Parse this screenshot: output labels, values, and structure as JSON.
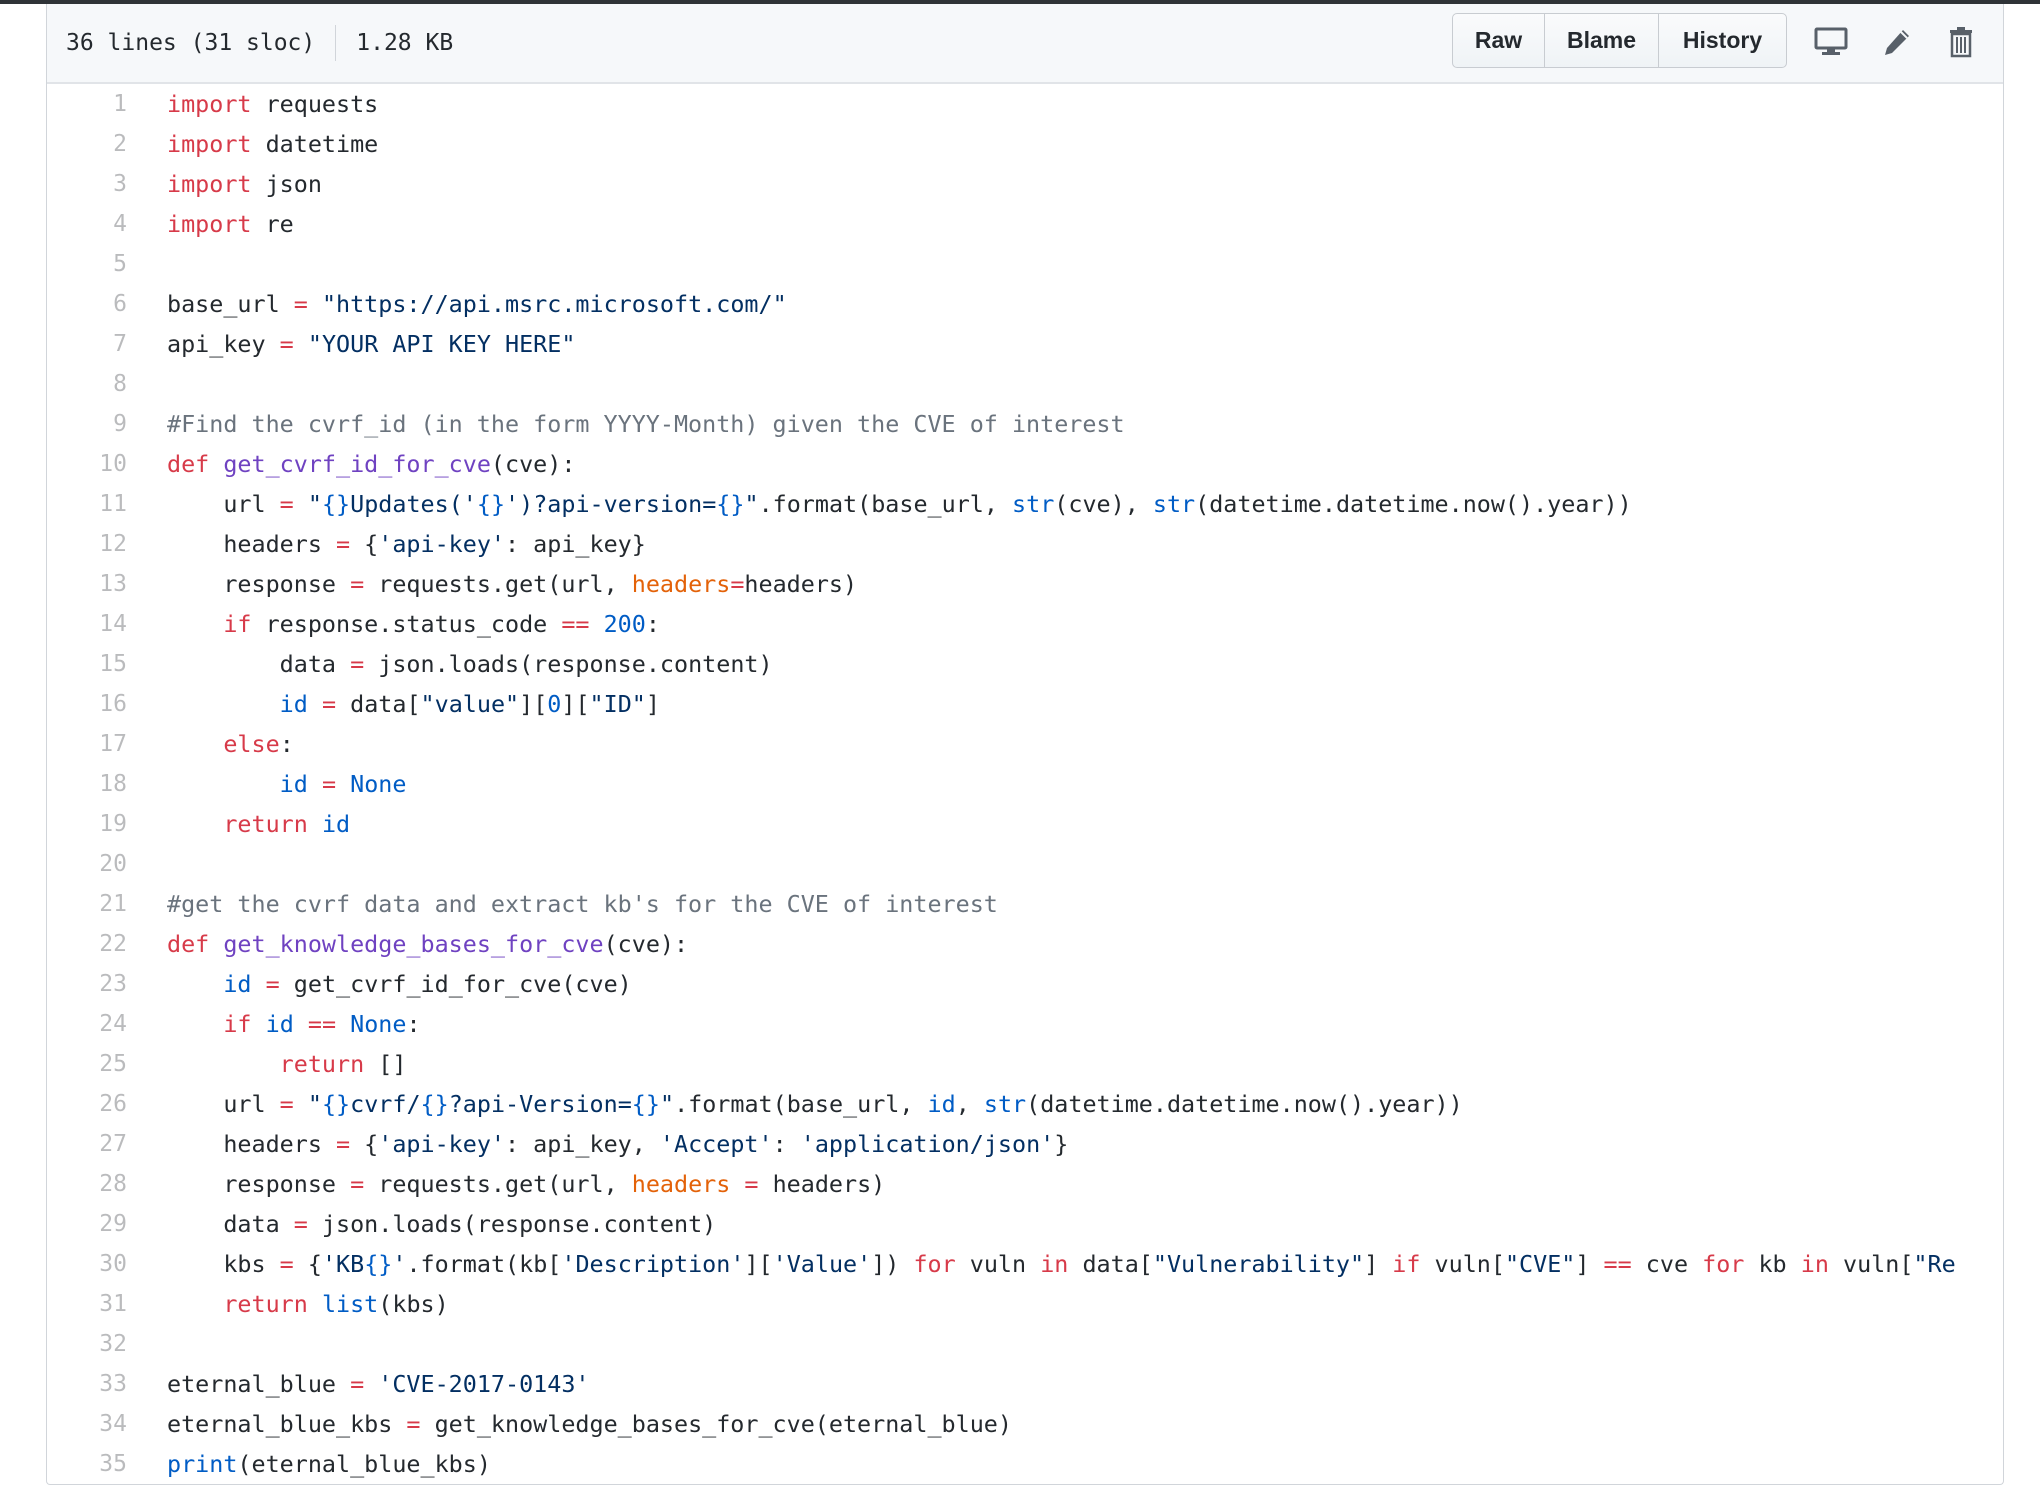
{
  "file_info": {
    "lines": "36 lines (31 sloc)",
    "size": "1.28 KB"
  },
  "actions": {
    "raw": "Raw",
    "blame": "Blame",
    "history": "History",
    "icons": [
      "desktop-icon",
      "pencil-icon",
      "trash-icon"
    ]
  },
  "colors": {
    "keyword": "#d73a49",
    "function": "#6f42c1",
    "string": "#032f62",
    "constant": "#005cc5",
    "parameter": "#e36209",
    "comment": "#6a737d",
    "text": "#24292e"
  },
  "lines": [
    {
      "n": "1",
      "tokens": [
        [
          "k",
          "import"
        ],
        [
          "t",
          " requests"
        ]
      ]
    },
    {
      "n": "2",
      "tokens": [
        [
          "k",
          "import"
        ],
        [
          "t",
          " datetime"
        ]
      ]
    },
    {
      "n": "3",
      "tokens": [
        [
          "k",
          "import"
        ],
        [
          "t",
          " json"
        ]
      ]
    },
    {
      "n": "4",
      "tokens": [
        [
          "k",
          "import"
        ],
        [
          "t",
          " re"
        ]
      ]
    },
    {
      "n": "5",
      "tokens": []
    },
    {
      "n": "6",
      "tokens": [
        [
          "t",
          "base_url "
        ],
        [
          "k",
          "="
        ],
        [
          "t",
          " "
        ],
        [
          "s",
          "\"https://api.msrc.microsoft.com/\""
        ]
      ]
    },
    {
      "n": "7",
      "tokens": [
        [
          "t",
          "api_key "
        ],
        [
          "k",
          "="
        ],
        [
          "t",
          " "
        ],
        [
          "s",
          "\"YOUR API KEY HERE\""
        ]
      ]
    },
    {
      "n": "8",
      "tokens": []
    },
    {
      "n": "9",
      "tokens": [
        [
          "c",
          "#Find the cvrf_id (in the form YYYY-Month) given the CVE of interest"
        ]
      ]
    },
    {
      "n": "10",
      "tokens": [
        [
          "k",
          "def"
        ],
        [
          "t",
          " "
        ],
        [
          "f",
          "get_cvrf_id_for_cve"
        ],
        [
          "t",
          "(cve):"
        ]
      ]
    },
    {
      "n": "11",
      "tokens": [
        [
          "t",
          "    url "
        ],
        [
          "k",
          "="
        ],
        [
          "t",
          " "
        ],
        [
          "s",
          "\""
        ],
        [
          "n",
          "{}"
        ],
        [
          "s",
          "Updates('"
        ],
        [
          "n",
          "{}"
        ],
        [
          "s",
          "')?api-version="
        ],
        [
          "n",
          "{}"
        ],
        [
          "s",
          "\""
        ],
        [
          "t",
          ".format(base_url, "
        ],
        [
          "n",
          "str"
        ],
        [
          "t",
          "(cve), "
        ],
        [
          "n",
          "str"
        ],
        [
          "t",
          "(datetime.datetime.now().year))"
        ]
      ]
    },
    {
      "n": "12",
      "tokens": [
        [
          "t",
          "    headers "
        ],
        [
          "k",
          "="
        ],
        [
          "t",
          " {"
        ],
        [
          "s",
          "'api-key'"
        ],
        [
          "t",
          ": api_key}"
        ]
      ]
    },
    {
      "n": "13",
      "tokens": [
        [
          "t",
          "    response "
        ],
        [
          "k",
          "="
        ],
        [
          "t",
          " requests.get(url, "
        ],
        [
          "o",
          "headers"
        ],
        [
          "k",
          "="
        ],
        [
          "t",
          "headers)"
        ]
      ]
    },
    {
      "n": "14",
      "tokens": [
        [
          "t",
          "    "
        ],
        [
          "k",
          "if"
        ],
        [
          "t",
          " response.status_code "
        ],
        [
          "k",
          "=="
        ],
        [
          "t",
          " "
        ],
        [
          "n",
          "200"
        ],
        [
          "t",
          ":"
        ]
      ]
    },
    {
      "n": "15",
      "tokens": [
        [
          "t",
          "        data "
        ],
        [
          "k",
          "="
        ],
        [
          "t",
          " json.loads(response.content)"
        ]
      ]
    },
    {
      "n": "16",
      "tokens": [
        [
          "t",
          "        "
        ],
        [
          "n",
          "id"
        ],
        [
          "t",
          " "
        ],
        [
          "k",
          "="
        ],
        [
          "t",
          " data["
        ],
        [
          "s",
          "\"value\""
        ],
        [
          "t",
          "]["
        ],
        [
          "n",
          "0"
        ],
        [
          "t",
          "]["
        ],
        [
          "s",
          "\"ID\""
        ],
        [
          "t",
          "]"
        ]
      ]
    },
    {
      "n": "17",
      "tokens": [
        [
          "t",
          "    "
        ],
        [
          "k",
          "else"
        ],
        [
          "t",
          ":"
        ]
      ]
    },
    {
      "n": "18",
      "tokens": [
        [
          "t",
          "        "
        ],
        [
          "n",
          "id"
        ],
        [
          "t",
          " "
        ],
        [
          "k",
          "="
        ],
        [
          "t",
          " "
        ],
        [
          "n",
          "None"
        ]
      ]
    },
    {
      "n": "19",
      "tokens": [
        [
          "t",
          "    "
        ],
        [
          "k",
          "return"
        ],
        [
          "t",
          " "
        ],
        [
          "n",
          "id"
        ]
      ]
    },
    {
      "n": "20",
      "tokens": []
    },
    {
      "n": "21",
      "tokens": [
        [
          "c",
          "#get the cvrf data and extract kb's for the CVE of interest"
        ]
      ]
    },
    {
      "n": "22",
      "tokens": [
        [
          "k",
          "def"
        ],
        [
          "t",
          " "
        ],
        [
          "f",
          "get_knowledge_bases_for_cve"
        ],
        [
          "t",
          "(cve):"
        ]
      ]
    },
    {
      "n": "23",
      "tokens": [
        [
          "t",
          "    "
        ],
        [
          "n",
          "id"
        ],
        [
          "t",
          " "
        ],
        [
          "k",
          "="
        ],
        [
          "t",
          " get_cvrf_id_for_cve(cve)"
        ]
      ]
    },
    {
      "n": "24",
      "tokens": [
        [
          "t",
          "    "
        ],
        [
          "k",
          "if"
        ],
        [
          "t",
          " "
        ],
        [
          "n",
          "id"
        ],
        [
          "t",
          " "
        ],
        [
          "k",
          "=="
        ],
        [
          "t",
          " "
        ],
        [
          "n",
          "None"
        ],
        [
          "t",
          ":"
        ]
      ]
    },
    {
      "n": "25",
      "tokens": [
        [
          "t",
          "        "
        ],
        [
          "k",
          "return"
        ],
        [
          "t",
          " []"
        ]
      ]
    },
    {
      "n": "26",
      "tokens": [
        [
          "t",
          "    url "
        ],
        [
          "k",
          "="
        ],
        [
          "t",
          " "
        ],
        [
          "s",
          "\""
        ],
        [
          "n",
          "{}"
        ],
        [
          "s",
          "cvrf/"
        ],
        [
          "n",
          "{}"
        ],
        [
          "s",
          "?api-Version="
        ],
        [
          "n",
          "{}"
        ],
        [
          "s",
          "\""
        ],
        [
          "t",
          ".format(base_url, "
        ],
        [
          "n",
          "id"
        ],
        [
          "t",
          ", "
        ],
        [
          "n",
          "str"
        ],
        [
          "t",
          "(datetime.datetime.now().year))"
        ]
      ]
    },
    {
      "n": "27",
      "tokens": [
        [
          "t",
          "    headers "
        ],
        [
          "k",
          "="
        ],
        [
          "t",
          " {"
        ],
        [
          "s",
          "'api-key'"
        ],
        [
          "t",
          ": api_key, "
        ],
        [
          "s",
          "'Accept'"
        ],
        [
          "t",
          ": "
        ],
        [
          "s",
          "'application/json'"
        ],
        [
          "t",
          "}"
        ]
      ]
    },
    {
      "n": "28",
      "tokens": [
        [
          "t",
          "    response "
        ],
        [
          "k",
          "="
        ],
        [
          "t",
          " requests.get(url, "
        ],
        [
          "o",
          "headers"
        ],
        [
          "t",
          " "
        ],
        [
          "k",
          "="
        ],
        [
          "t",
          " headers)"
        ]
      ]
    },
    {
      "n": "29",
      "tokens": [
        [
          "t",
          "    data "
        ],
        [
          "k",
          "="
        ],
        [
          "t",
          " json.loads(response.content)"
        ]
      ]
    },
    {
      "n": "30",
      "tokens": [
        [
          "t",
          "    kbs "
        ],
        [
          "k",
          "="
        ],
        [
          "t",
          " {"
        ],
        [
          "s",
          "'KB"
        ],
        [
          "n",
          "{}"
        ],
        [
          "s",
          "'"
        ],
        [
          "t",
          ".format(kb["
        ],
        [
          "s",
          "'Description'"
        ],
        [
          "t",
          "]["
        ],
        [
          "s",
          "'Value'"
        ],
        [
          "t",
          "]) "
        ],
        [
          "k",
          "for"
        ],
        [
          "t",
          " vuln "
        ],
        [
          "k",
          "in"
        ],
        [
          "t",
          " data["
        ],
        [
          "s",
          "\"Vulnerability\""
        ],
        [
          "t",
          "] "
        ],
        [
          "k",
          "if"
        ],
        [
          "t",
          " vuln["
        ],
        [
          "s",
          "\"CVE\""
        ],
        [
          "t",
          "] "
        ],
        [
          "k",
          "=="
        ],
        [
          "t",
          " cve "
        ],
        [
          "k",
          "for"
        ],
        [
          "t",
          " kb "
        ],
        [
          "k",
          "in"
        ],
        [
          "t",
          " vuln["
        ],
        [
          "s",
          "\"Re"
        ]
      ]
    },
    {
      "n": "31",
      "tokens": [
        [
          "t",
          "    "
        ],
        [
          "k",
          "return"
        ],
        [
          "t",
          " "
        ],
        [
          "n",
          "list"
        ],
        [
          "t",
          "(kbs)"
        ]
      ]
    },
    {
      "n": "32",
      "tokens": []
    },
    {
      "n": "33",
      "tokens": [
        [
          "t",
          "eternal_blue "
        ],
        [
          "k",
          "="
        ],
        [
          "t",
          " "
        ],
        [
          "s",
          "'CVE-2017-0143'"
        ]
      ]
    },
    {
      "n": "34",
      "tokens": [
        [
          "t",
          "eternal_blue_kbs "
        ],
        [
          "k",
          "="
        ],
        [
          "t",
          " get_knowledge_bases_for_cve(eternal_blue)"
        ]
      ]
    },
    {
      "n": "35",
      "tokens": [
        [
          "n",
          "print"
        ],
        [
          "t",
          "(eternal_blue_kbs)"
        ]
      ]
    }
  ]
}
